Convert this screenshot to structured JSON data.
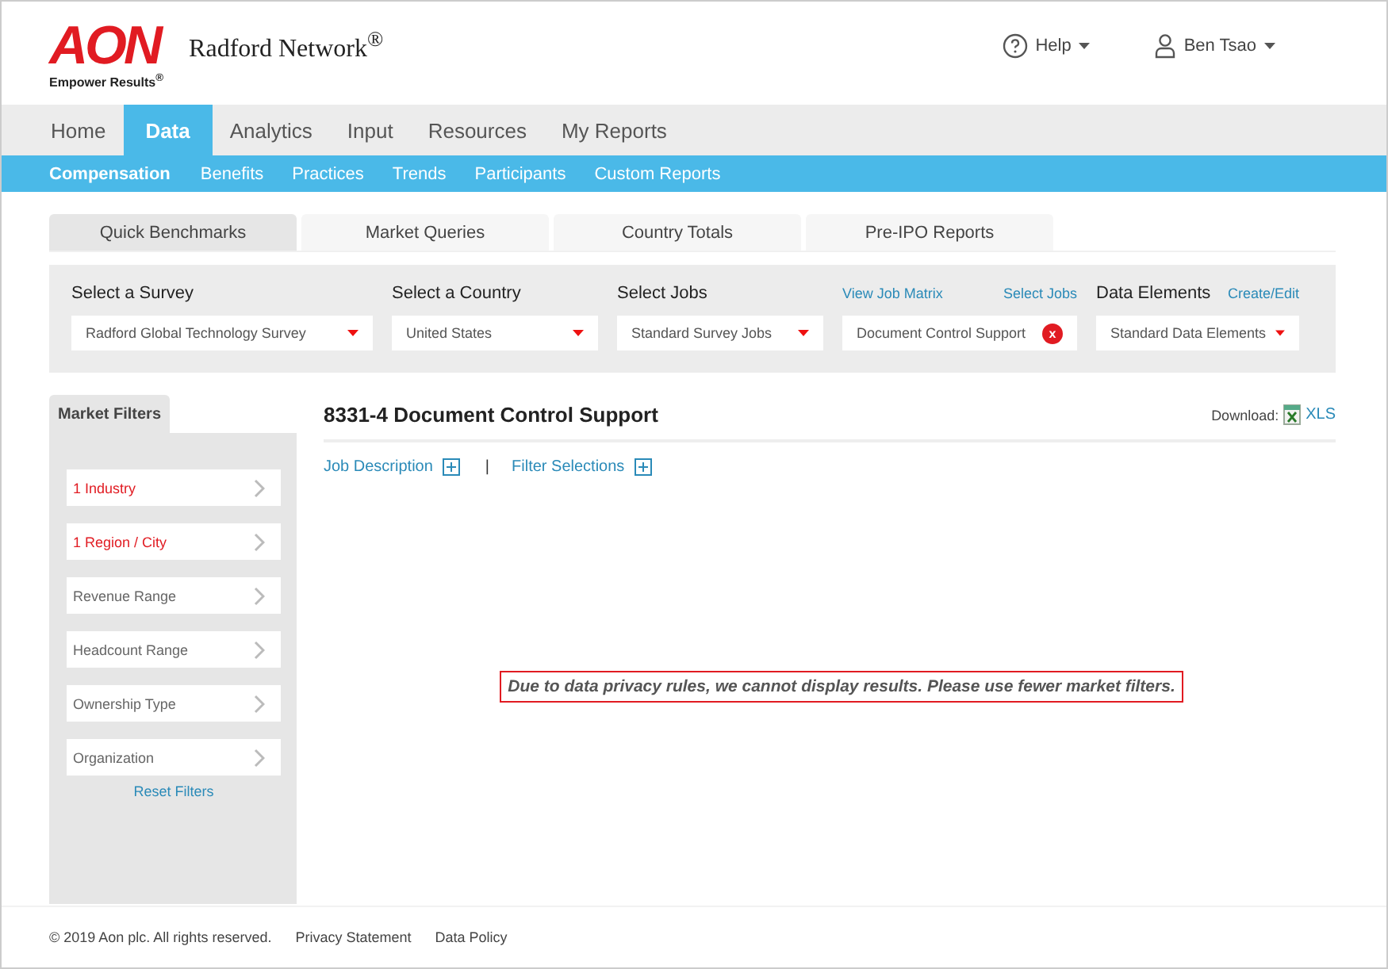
{
  "header": {
    "logo": "AON",
    "tagline": "Empower Results$^{®}$",
    "product": "Radford Network$^{®}$",
    "help": "Help",
    "user": "Ben Tsao"
  },
  "nav": [
    {
      "label": "Home",
      "selected": false
    },
    {
      "label": "Data",
      "selected": true
    },
    {
      "label": "Analytics",
      "selected": false
    },
    {
      "label": "Input",
      "selected": false
    },
    {
      "label": "Resources",
      "selected": false
    },
    {
      "label": "My Reports",
      "selected": false
    }
  ],
  "subnav": [
    {
      "label": "Compensation",
      "selected": true
    },
    {
      "label": "Benefits",
      "selected": false
    },
    {
      "label": "Practices",
      "selected": false
    },
    {
      "label": "Trends",
      "selected": false
    },
    {
      "label": "Participants",
      "selected": false
    },
    {
      "label": "Custom Reports",
      "selected": false
    }
  ],
  "tabs": [
    {
      "label": "Quick Benchmarks",
      "selected": true
    },
    {
      "label": "Market Queries",
      "selected": false
    },
    {
      "label": "Country Totals",
      "selected": false
    },
    {
      "label": "Pre-IPO Reports",
      "selected": false
    }
  ],
  "selectors": {
    "survey": {
      "label": "Select a Survey",
      "value": "Radford Global Technology Survey"
    },
    "country": {
      "label": "Select a Country",
      "value": "United States"
    },
    "jobs": {
      "label": "Select Jobs",
      "value": "Standard Survey Jobs",
      "link_1": "View Job Matrix",
      "link_2": "Select Jobs",
      "chip": "Document Control Support",
      "remove": "x"
    },
    "elements": {
      "label": "Data Elements",
      "link": "Create/Edit",
      "value": "Standard Data Elements"
    }
  },
  "filters": {
    "title": "Market Filters",
    "items": [
      {
        "label": "1 Industry",
        "active": true
      },
      {
        "label": "1 Region / City",
        "active": true
      },
      {
        "label": "Revenue Range",
        "active": false
      },
      {
        "label": "Headcount Range",
        "active": false
      },
      {
        "label": "Ownership Type",
        "active": false
      },
      {
        "label": "Organization",
        "active": false
      }
    ],
    "reset": "Reset Filters"
  },
  "job": {
    "title": "8331-4 Document Control Support",
    "download": "Download:",
    "xls": "XLS",
    "links": [
      "Job Description",
      "Filter Selections"
    ],
    "separator": "|",
    "message": "Due to data privacy rules, we cannot display results. Please use fewer market filters."
  },
  "footer": [
    "© 2019 Aon plc. All rights reserved.",
    "Privacy Statement",
    "Data Policy"
  ]
}
